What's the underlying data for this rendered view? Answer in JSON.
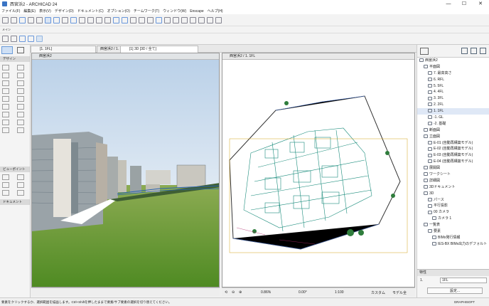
{
  "window": {
    "title": "西宮浜2 - ARCHICAD 24",
    "min": "—",
    "max": "☐",
    "close": "✕"
  },
  "menu": [
    "ファイル(F)",
    "編集(E)",
    "表示(V)",
    "デザイン(D)",
    "ドキュメント(C)",
    "オプション(O)",
    "チームワーク(T)",
    "ウィンドウ(W)",
    "Enscape",
    "ヘルプ(H)"
  ],
  "toolbar2": {
    "label": "メイン"
  },
  "tabs": {
    "floor_field": "[1. 1FL]",
    "t1": "西宮浜2 / 1. 1FL",
    "t2": "[1] 3D [3D / 全て]"
  },
  "left": {
    "design": "デザイン",
    "viewpoint": "ビューポイント",
    "document": "ドキュメント"
  },
  "view3d": {
    "header": "西宮浜2"
  },
  "plan": {
    "header": "西宮浜2 / 1. 1FL"
  },
  "planstatus": {
    "zoom": "0.86%",
    "angle": "0.00°",
    "scale": "1:100",
    "custom": "カスタム",
    "model": "モデル全"
  },
  "navigator": {
    "items": [
      {
        "label": "西宮浜2",
        "indent": 0,
        "sel": false
      },
      {
        "label": "平面図",
        "indent": 1,
        "sel": false
      },
      {
        "label": "7. 最高高さ",
        "indent": 2,
        "sel": false
      },
      {
        "label": "6. RFL",
        "indent": 2,
        "sel": false
      },
      {
        "label": "5. 5FL",
        "indent": 2,
        "sel": false
      },
      {
        "label": "4. 4FL",
        "indent": 2,
        "sel": false
      },
      {
        "label": "3. 3FL",
        "indent": 2,
        "sel": false
      },
      {
        "label": "2. 2FL",
        "indent": 2,
        "sel": false
      },
      {
        "label": "1. 1FL",
        "indent": 2,
        "sel": true
      },
      {
        "label": "-1. GL",
        "indent": 2,
        "sel": false
      },
      {
        "label": "-2. 基礎",
        "indent": 2,
        "sel": false
      },
      {
        "label": "断面図",
        "indent": 1,
        "sel": false
      },
      {
        "label": "立面図",
        "indent": 1,
        "sel": false
      },
      {
        "label": "E-01 (自動再構築モデル)",
        "indent": 2,
        "sel": false
      },
      {
        "label": "E-02 (自動再構築モデル)",
        "indent": 2,
        "sel": false
      },
      {
        "label": "E-03 (自動再構築モデル)",
        "indent": 2,
        "sel": false
      },
      {
        "label": "E-04 (自動再構築モデル)",
        "indent": 2,
        "sel": false
      },
      {
        "label": "展開図",
        "indent": 1,
        "sel": false
      },
      {
        "label": "ワークシート",
        "indent": 1,
        "sel": false
      },
      {
        "label": "詳細図",
        "indent": 1,
        "sel": false
      },
      {
        "label": "3Dドキュメント",
        "indent": 1,
        "sel": false
      },
      {
        "label": "3D",
        "indent": 1,
        "sel": false
      },
      {
        "label": "パース",
        "indent": 2,
        "sel": false
      },
      {
        "label": "平行投影",
        "indent": 2,
        "sel": false
      },
      {
        "label": "00 カメラ",
        "indent": 2,
        "sel": false
      },
      {
        "label": "カメラ 1",
        "indent": 3,
        "sel": false
      },
      {
        "label": "一覧表",
        "indent": 1,
        "sel": false
      },
      {
        "label": "要素",
        "indent": 2,
        "sel": false
      },
      {
        "label": "BIMx発行情報",
        "indent": 3,
        "sel": false
      },
      {
        "label": "IES-BX BIMx出力のデフォルト",
        "indent": 3,
        "sel": false
      }
    ],
    "props_label": "特性",
    "props_val1": "1.",
    "props_val2": "1FL",
    "settings": "設定..."
  },
  "status": {
    "text": "要素をクリックするか、選択範囲を描画します。Ctrl+Shiftを押したままで要素/サブ要素の選択を切り替えてください。",
    "brand": "GRAPHISOFT"
  }
}
